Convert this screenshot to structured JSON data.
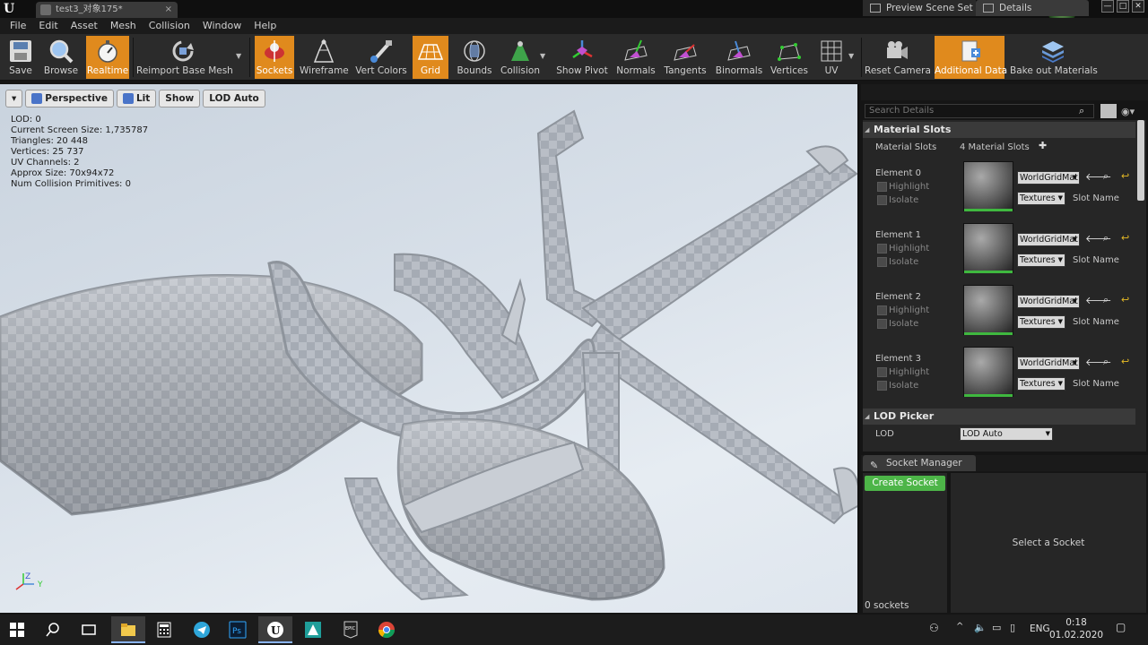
{
  "window": {
    "tab_title": "test3_对象175*",
    "controls": [
      "—",
      "□",
      "✕"
    ]
  },
  "menu": [
    "File",
    "Edit",
    "Asset",
    "Mesh",
    "Collision",
    "Window",
    "Help"
  ],
  "toolbar": {
    "save": "Save",
    "browse": "Browse",
    "realtime": "Realtime",
    "reimport": "Reimport Base Mesh",
    "sockets": "Sockets",
    "wireframe": "Wireframe",
    "vert_colors": "Vert Colors",
    "grid": "Grid",
    "bounds": "Bounds",
    "collision": "Collision",
    "show_pivot": "Show Pivot",
    "normals": "Normals",
    "tangents": "Tangents",
    "binormals": "Binormals",
    "vertices": "Vertices",
    "uv": "UV",
    "reset_camera": "Reset Camera",
    "additional_data": "Additional Data",
    "bake_out": "Bake out Materials",
    "active_color": "#e08a1d"
  },
  "viewport": {
    "dropdown": "▾",
    "perspective": "Perspective",
    "lit": "Lit",
    "show": "Show",
    "lod": "LOD Auto",
    "stats": [
      "LOD:  0",
      "Current Screen Size:  1,735787",
      "Triangles:  20 448",
      "Vertices:  25 737",
      "UV Channels:  2",
      "Approx Size: 70x94x72",
      "Num Collision Primitives:  0"
    ],
    "axis_z": "Z",
    "axis_y": "Y",
    "background_color": "#d8e0e9"
  },
  "panel": {
    "tab_preview": "Preview Scene Set",
    "tab_details": "Details",
    "search_placeholder": "Search Details",
    "material_slots_header": "Material Slots",
    "material_slots_label": "Material Slots",
    "material_slots_count": "4 Material Slots",
    "add": "✚",
    "elements": [
      {
        "name": "Element 0",
        "highlight": "Highlight",
        "isolate": "Isolate",
        "material": "WorldGridMat",
        "textures": "Textures",
        "slot": "Slot Name"
      },
      {
        "name": "Element 1",
        "highlight": "Highlight",
        "isolate": "Isolate",
        "material": "WorldGridMat",
        "textures": "Textures",
        "slot": "Slot Name"
      },
      {
        "name": "Element 2",
        "highlight": "Highlight",
        "isolate": "Isolate",
        "material": "WorldGridMat",
        "textures": "Textures",
        "slot": "Slot Name"
      },
      {
        "name": "Element 3",
        "highlight": "Highlight",
        "isolate": "Isolate",
        "material": "WorldGridMat",
        "textures": "Textures",
        "slot": "Slot Name"
      }
    ],
    "lod_picker_header": "LOD Picker",
    "lod_label": "LOD",
    "lod_value": "LOD Auto"
  },
  "socket_manager": {
    "tab": "Socket Manager",
    "create": "Create Socket",
    "count": "0 sockets",
    "select": "Select a Socket",
    "create_color": "#4db548"
  },
  "taskbar": {
    "lang": "ENG",
    "time": "0:18",
    "date": "01.02.2020"
  }
}
